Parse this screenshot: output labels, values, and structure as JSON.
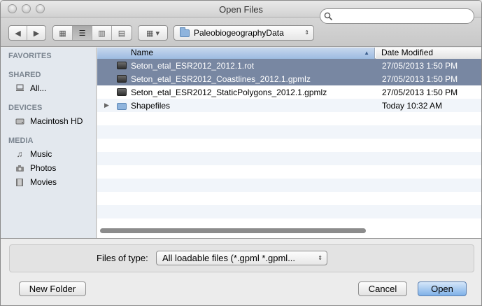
{
  "window": {
    "title": "Open Files"
  },
  "toolbar": {
    "nav": {
      "back_label": "◀",
      "forward_label": "▶"
    },
    "views": {
      "icon": "▦",
      "list": "☰",
      "column": "▥",
      "coverflow": "▤"
    },
    "arrange": {
      "label": "▦ ▾"
    },
    "path": {
      "folder": "PaleobiogeographyData",
      "updown": "⇕"
    },
    "search": {
      "value": "",
      "placeholder": ""
    }
  },
  "sidebar": {
    "sections": [
      {
        "header": "FAVORITES",
        "items": []
      },
      {
        "header": "SHARED",
        "items": [
          {
            "label": "All...",
            "icon": "network-icon"
          }
        ]
      },
      {
        "header": "DEVICES",
        "items": [
          {
            "label": "Macintosh HD",
            "icon": "drive-icon"
          }
        ]
      },
      {
        "header": "MEDIA",
        "items": [
          {
            "label": "Music",
            "icon": "music-note-icon"
          },
          {
            "label": "Photos",
            "icon": "camera-icon"
          },
          {
            "label": "Movies",
            "icon": "film-icon"
          }
        ]
      }
    ]
  },
  "file_list": {
    "columns": {
      "name": "Name",
      "date": "Date Modified"
    },
    "rows": [
      {
        "name": "Seton_etal_ESR2012_2012.1.rot",
        "date": "27/05/2013 1:50 PM",
        "selected": true,
        "type": "file"
      },
      {
        "name": "Seton_etal_ESR2012_Coastlines_2012.1.gpmlz",
        "date": "27/05/2013 1:50 PM",
        "selected": true,
        "type": "file"
      },
      {
        "name": "Seton_etal_ESR2012_StaticPolygons_2012.1.gpmlz",
        "date": "27/05/2013 1:50 PM",
        "selected": false,
        "type": "file"
      },
      {
        "name": "Shapefiles",
        "date": "Today 10:32 AM",
        "selected": false,
        "type": "folder"
      }
    ]
  },
  "filter": {
    "label": "Files of type:",
    "value": "All loadable files (*.gpml *.gpml...",
    "arrows": "⇕"
  },
  "buttons": {
    "new_folder": "New Folder",
    "cancel": "Cancel",
    "open": "Open"
  },
  "colors": {
    "selection": "#7887a2",
    "header_active": "#9dbbe1",
    "primary_button": "#7fb1e8"
  }
}
